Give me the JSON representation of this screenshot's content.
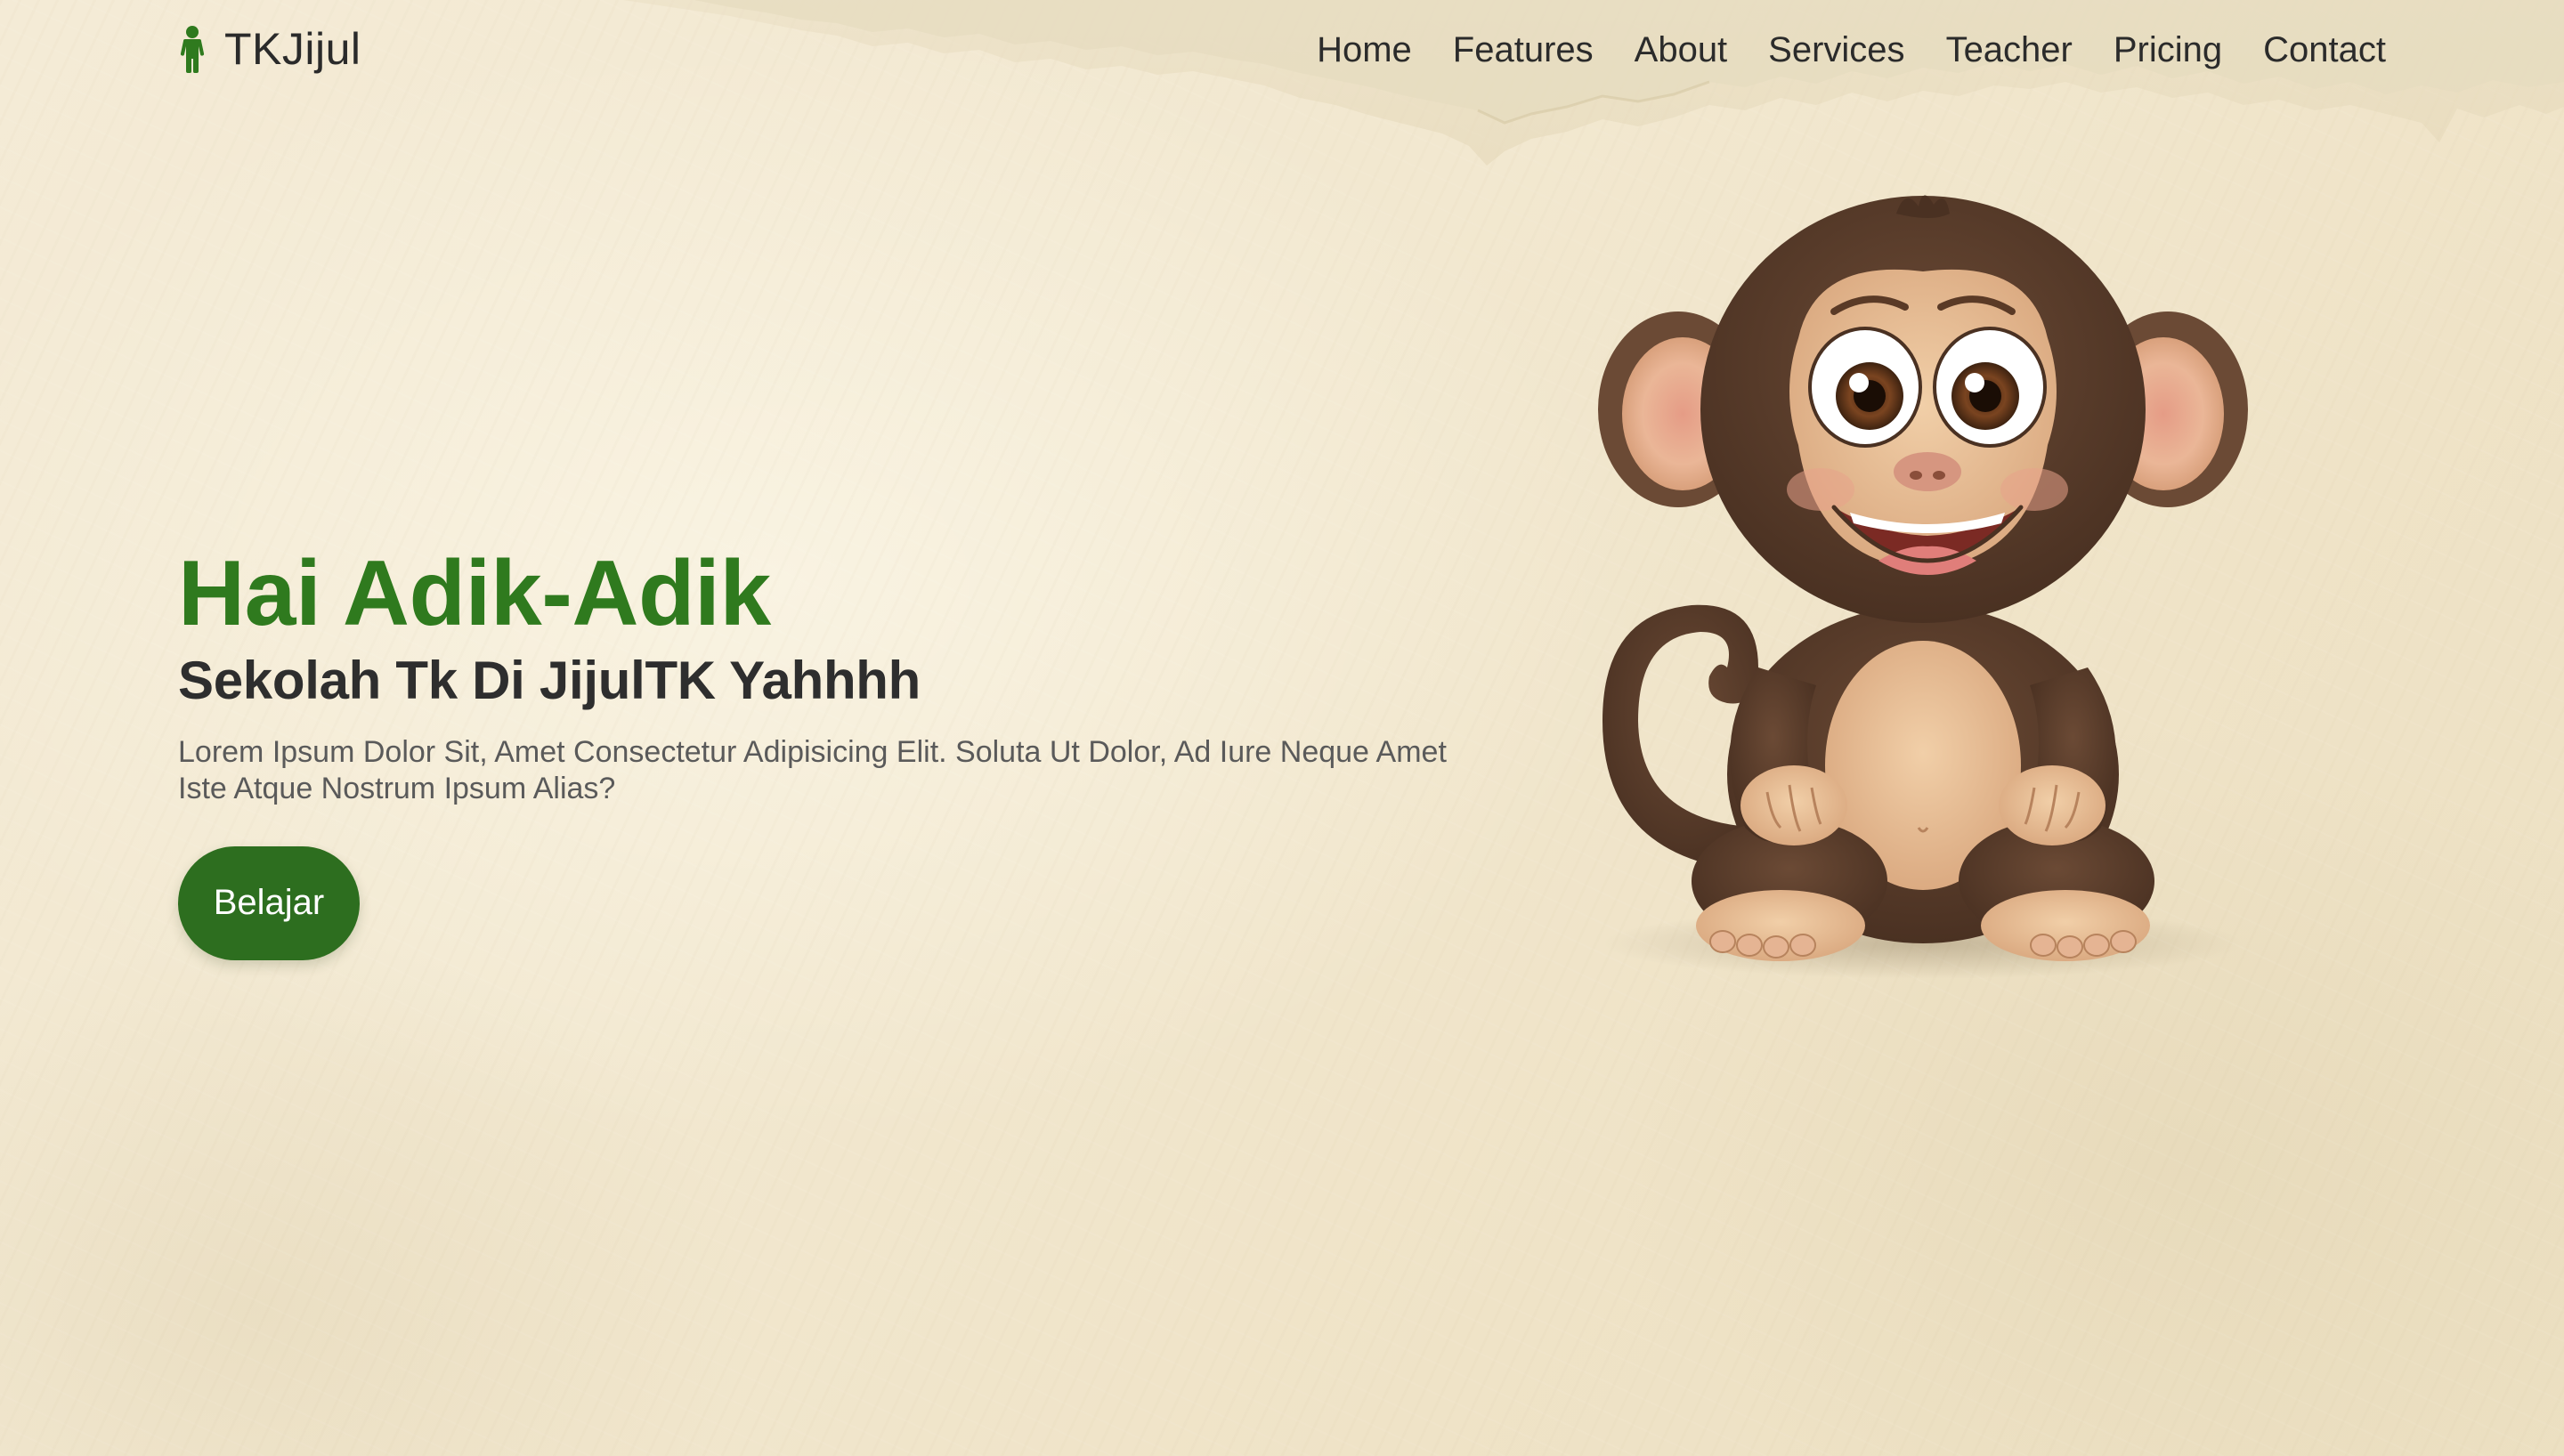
{
  "navbar": {
    "brand": "TKJijul",
    "brand_icon": "person-icon",
    "links": [
      {
        "label": "Home"
      },
      {
        "label": "Features"
      },
      {
        "label": "About"
      },
      {
        "label": "Services"
      },
      {
        "label": "Teacher"
      },
      {
        "label": "Pricing"
      },
      {
        "label": "Contact"
      }
    ]
  },
  "hero": {
    "title": "Hai Adik-Adik",
    "subtitle": "Sekolah Tk Di JijulTK Yahhhh",
    "description": "Lorem Ipsum Dolor Sit, Amet Consectetur Adipisicing Elit. Soluta Ut Dolor, Ad Iure Neque Amet Iste Atque Nostrum Ipsum Alias?",
    "button_label": "Belajar",
    "illustration": "monkey-illustration"
  },
  "colors": {
    "brand_green": "#2f7a1e",
    "button_green": "#2d6e1f",
    "background": "#f2e8d0",
    "text_dark": "#2e2e2e"
  }
}
